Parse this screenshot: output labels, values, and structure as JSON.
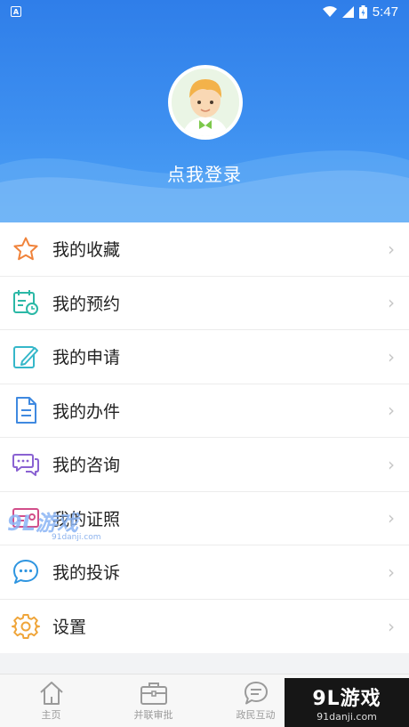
{
  "status_bar": {
    "time": "5:47",
    "notification_glyph": "A"
  },
  "profile": {
    "login_prompt": "点我登录",
    "avatar_icon": "boy-avatar-icon"
  },
  "menu": [
    {
      "label": "我的收藏",
      "icon": "star-icon",
      "chevron": "›"
    },
    {
      "label": "我的预约",
      "icon": "calendar-clock-icon",
      "chevron": "›"
    },
    {
      "label": "我的申请",
      "icon": "edit-pen-icon",
      "chevron": "›"
    },
    {
      "label": "我的办件",
      "icon": "document-icon",
      "chevron": "›"
    },
    {
      "label": "我的咨询",
      "icon": "chat-bubbles-icon",
      "chevron": "›"
    },
    {
      "label": "我的证照",
      "icon": "id-card-icon",
      "chevron": "›"
    },
    {
      "label": "我的投诉",
      "icon": "speech-dots-icon",
      "chevron": "›"
    },
    {
      "label": "设置",
      "icon": "gear-icon",
      "chevron": "›"
    }
  ],
  "tabs": [
    {
      "label": "主页",
      "icon": "home-icon"
    },
    {
      "label": "并联审批",
      "icon": "briefcase-icon"
    },
    {
      "label": "政民互动",
      "icon": "chat-icon"
    }
  ],
  "watermark": {
    "brand": "9L游戏",
    "site": "91danji.com"
  },
  "colors": {
    "header_blue": "#3d8ff0",
    "tab_gray": "#9a9a9a"
  }
}
